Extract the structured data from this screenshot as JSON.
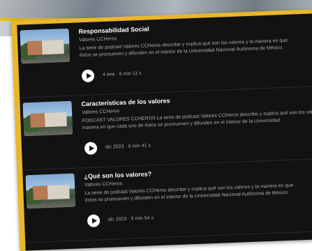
{
  "episodes": [
    {
      "title": "Responsabilidad Social",
      "show": "Valores CCHeros",
      "desc_line1": "La serie de podcast Valores CCHeros describe y explica qué son los valores y la manera en que",
      "desc_line2": "éstos se promueven y difunden en el interior de la Universidad Nacional Autónoma de México.",
      "date": "4 ene",
      "duration": "6 min 11 s"
    },
    {
      "title": "Características de los valores",
      "show": "Valores CCHeros",
      "desc_line1": "PODCAST VALORES CCHEROS  La serie de podcast Valores CCHeros describe y explica qué son los valores y la",
      "desc_line2": "manera en que cada uno de éstos se promueven y difunden en el interior de la Universidad",
      "date": "dic 2023",
      "duration": "6 min 41 s"
    },
    {
      "title": "¿Qué son los valores?",
      "show": "Valores CCHeros",
      "desc_line1": "La serie de podcast Valores CCHeros describe y explica qué son los valores y la manera en que",
      "desc_line2": "éstos se promueven y difunden en el interior de la Universidad Nacional Autónoma de México.",
      "date": "dic 2023",
      "duration": "9 min 54 s"
    }
  ],
  "separator": "·"
}
